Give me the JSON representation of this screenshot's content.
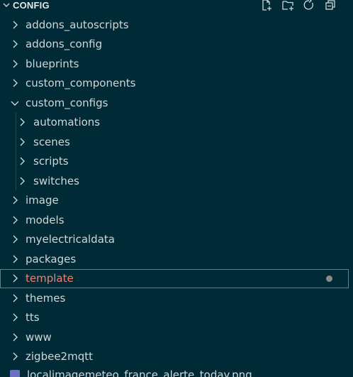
{
  "explorer": {
    "title": "CONFIG",
    "actions": [
      {
        "name": "new-file-icon"
      },
      {
        "name": "new-folder-icon"
      },
      {
        "name": "refresh-icon"
      },
      {
        "name": "collapse-all-icon"
      }
    ]
  },
  "tree": {
    "items": [
      {
        "label": "addons_autoscripts",
        "level": 0,
        "expanded": false
      },
      {
        "label": "addons_config",
        "level": 0,
        "expanded": false
      },
      {
        "label": "blueprints",
        "level": 0,
        "expanded": false
      },
      {
        "label": "custom_components",
        "level": 0,
        "expanded": false
      },
      {
        "label": "custom_configs",
        "level": 0,
        "expanded": true
      },
      {
        "label": "automations",
        "level": 1,
        "expanded": false
      },
      {
        "label": "scenes",
        "level": 1,
        "expanded": false
      },
      {
        "label": "scripts",
        "level": 1,
        "expanded": false
      },
      {
        "label": "switches",
        "level": 1,
        "expanded": false
      },
      {
        "label": "image",
        "level": 0,
        "expanded": false
      },
      {
        "label": "models",
        "level": 0,
        "expanded": false
      },
      {
        "label": "myelectricaldata",
        "level": 0,
        "expanded": false
      },
      {
        "label": "packages",
        "level": 0,
        "expanded": false
      },
      {
        "label": "template",
        "level": 0,
        "expanded": false,
        "selected": true,
        "modified": true
      },
      {
        "label": "themes",
        "level": 0,
        "expanded": false
      },
      {
        "label": "tts",
        "level": 0,
        "expanded": false
      },
      {
        "label": "www",
        "level": 0,
        "expanded": false
      },
      {
        "label": "zigbee2mqtt",
        "level": 0,
        "expanded": false
      }
    ],
    "partial_file": {
      "label": "localimagemeteo_france_alerte_today.png"
    }
  },
  "colors": {
    "background": "#002b36",
    "selected_label": "#f47f6f",
    "selection_border": "#5f7f8a",
    "modified_dot": "#8a8a8a"
  }
}
